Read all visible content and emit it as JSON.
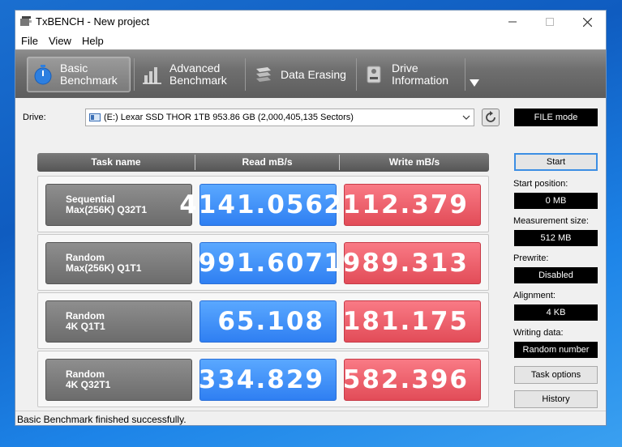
{
  "window": {
    "title": "TxBENCH - New project"
  },
  "menu": [
    "File",
    "View",
    "Help"
  ],
  "toolbar": {
    "tabs": [
      {
        "label": "Basic\nBenchmark",
        "icon": "stopwatch-icon"
      },
      {
        "label": "Advanced\nBenchmark",
        "icon": "bar-chart-icon"
      },
      {
        "label": "Data Erasing",
        "icon": "eraser-icon"
      },
      {
        "label": "Drive\nInformation",
        "icon": "drive-info-icon"
      }
    ]
  },
  "drive": {
    "label": "Drive:",
    "selected": "(E:) Lexar SSD THOR 1TB  953.86 GB (2,000,405,135 Sectors)",
    "mode": "FILE mode"
  },
  "table": {
    "headers": [
      "Task name",
      "Read mB/s",
      "Write mB/s"
    ],
    "rows": [
      {
        "task_line1": "Sequential",
        "task_line2": "Max(256K) Q32T1",
        "read": "4141.056",
        "write": "2112.379"
      },
      {
        "task_line1": "Random",
        "task_line2": "Max(256K) Q1T1",
        "read": "991.607",
        "write": "1989.313"
      },
      {
        "task_line1": "Random",
        "task_line2": "4K Q1T1",
        "read": "65.108",
        "write": "181.175"
      },
      {
        "task_line1": "Random",
        "task_line2": "4K Q32T1",
        "read": "334.829",
        "write": "582.396"
      }
    ]
  },
  "side": {
    "start_label": "Start",
    "start_position_label": "Start position:",
    "start_position": "0 MB",
    "measurement_size_label": "Measurement size:",
    "measurement_size": "512 MB",
    "prewrite_label": "Prewrite:",
    "prewrite": "Disabled",
    "alignment_label": "Alignment:",
    "alignment": "4 KB",
    "writing_data_label": "Writing data:",
    "writing_data": "Random number",
    "task_options_label": "Task options",
    "history_label": "History"
  },
  "status": "Basic Benchmark finished successfully.",
  "colors": {
    "read": "#3d8ef8",
    "write": "#ee5f6b",
    "toolbar": "#6f6f6f"
  }
}
